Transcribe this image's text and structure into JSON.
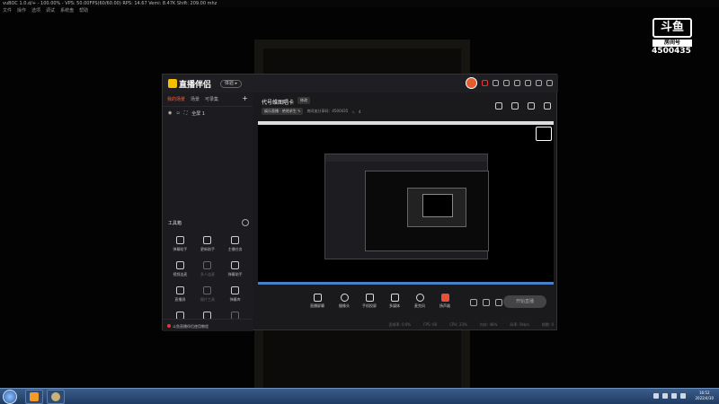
{
  "player": {
    "title": "vuBOC 1.0.d/+ - 100.00% - VPS: 50.00FPS(60/60.00) RPS: 14.67 Vemi: 8.47K Shift: 209.00 mhz",
    "menu": [
      "文件",
      "操作",
      "选项",
      "调试",
      "系统盘",
      "帮助"
    ]
  },
  "watermark": {
    "mark": "斗鱼",
    "label": "房间号",
    "room_id": "4500435"
  },
  "app": {
    "brand": "直播伴侣",
    "version_pill": "体验 ▸",
    "sidebar": {
      "tabs": [
        "我的场景",
        "场景",
        "可录集"
      ],
      "active_tab": "我的场景",
      "plus": "+",
      "scene_label": "全屏 1",
      "tools_title": "工具箱",
      "tools": [
        {
          "label": "弹幕助手",
          "dim": false
        },
        {
          "label": "更新助手",
          "dim": false
        },
        {
          "label": "主播任务",
          "dim": false
        },
        {
          "label": "视频连麦",
          "dim": false
        },
        {
          "label": "多人连麦",
          "dim": true
        },
        {
          "label": "弹幕助手",
          "dim": false
        },
        {
          "label": "直播屏",
          "dim": false
        },
        {
          "label": "图片工具",
          "dim": true
        },
        {
          "label": "弹幕库",
          "dim": false
        },
        {
          "label": "",
          "dim": false
        },
        {
          "label": "",
          "dim": false
        },
        {
          "label": "",
          "dim": true
        }
      ],
      "footer": "斗鱼直播伴侣使用教程"
    },
    "main": {
      "room_title": "代号维图唱卡",
      "room_edit": "修改",
      "tag": "娱乐直播 · 绝地求生 ✎",
      "room_info": "房间加分享码：4500435",
      "fans": "4",
      "controls": [
        {
          "label": "直播屏幕"
        },
        {
          "label": "摄像头"
        },
        {
          "label": "手机投屏"
        },
        {
          "label": "多媒体"
        },
        {
          "label": "麦克风"
        },
        {
          "label": "扬声器"
        }
      ],
      "go_live": "开始直播",
      "status": [
        "丢帧率: 0.0%",
        "FPS: 60",
        "CPU: 23%",
        "内存: 48%",
        "码率: 0kb/s",
        "帧数: 0"
      ]
    }
  },
  "taskbar": {
    "time": "16:52",
    "date": "2022/4/30"
  }
}
